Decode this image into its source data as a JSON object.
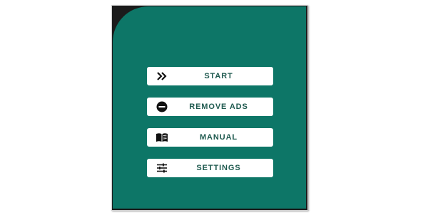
{
  "colors": {
    "screen_background": "#0d7667",
    "button_background": "#ffffff",
    "button_text": "#1f5a4f",
    "icon": "#111111",
    "frame": "#1b1b1b"
  },
  "menu": {
    "items": [
      {
        "label": "START",
        "icon": "fast-forward-icon"
      },
      {
        "label": "REMOVE ADS",
        "icon": "remove-circle-icon"
      },
      {
        "label": "MANUAL",
        "icon": "book-icon"
      },
      {
        "label": "SETTINGS",
        "icon": "sliders-icon"
      }
    ]
  }
}
